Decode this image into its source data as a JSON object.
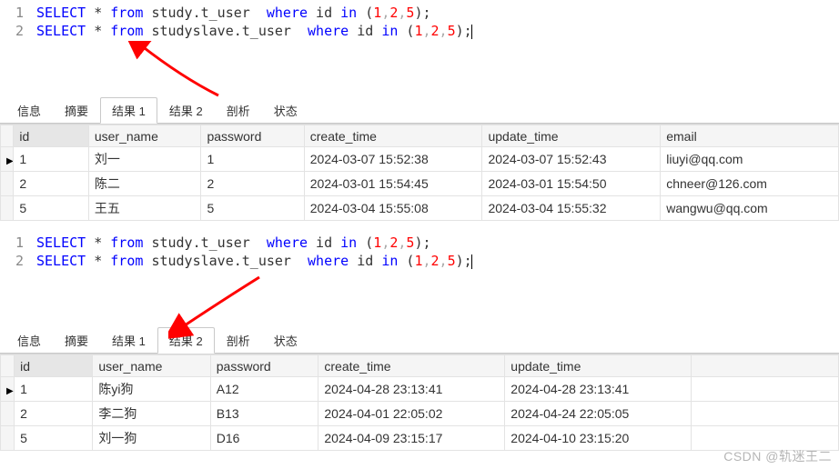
{
  "editor1": {
    "line1_num": "1",
    "line2_num": "2",
    "kw_select": "SELECT",
    "star": " * ",
    "kw_from": "from",
    "sp": " ",
    "table1": "study.t_user",
    "table2": "studyslave.t_user",
    "spc2": "  ",
    "kw_where": "where",
    "id_col": " id ",
    "kw_in": "in",
    "lp": " (",
    "n1": "1",
    "com": ",",
    "n2": "2",
    "n5": "5",
    "rp": ");"
  },
  "tabs": {
    "info": "信息",
    "summary": "摘要",
    "result1": "结果 1",
    "result2": "结果 2",
    "profile": "剖析",
    "status": "状态"
  },
  "grid1": {
    "headers": {
      "id": "id",
      "user_name": "user_name",
      "password": "password",
      "create_time": "create_time",
      "update_time": "update_time",
      "email": "email"
    },
    "rows": [
      {
        "id": "1",
        "user_name": "刘一",
        "password": "1",
        "create_time": "2024-03-07 15:52:38",
        "update_time": "2024-03-07 15:52:43",
        "email": "liuyi@qq.com"
      },
      {
        "id": "2",
        "user_name": "陈二",
        "password": "2",
        "create_time": "2024-03-01 15:54:45",
        "update_time": "2024-03-01 15:54:50",
        "email": "chneer@126.com"
      },
      {
        "id": "5",
        "user_name": "王五",
        "password": "5",
        "create_time": "2024-03-04 15:55:08",
        "update_time": "2024-03-04 15:55:32",
        "email": "wangwu@qq.com"
      }
    ]
  },
  "grid2": {
    "headers": {
      "id": "id",
      "user_name": "user_name",
      "password": "password",
      "create_time": "create_time",
      "update_time": "update_time"
    },
    "rows": [
      {
        "id": "1",
        "user_name": "陈yi狗",
        "password": "A12",
        "create_time": "2024-04-28 23:13:41",
        "update_time": "2024-04-28 23:13:41"
      },
      {
        "id": "2",
        "user_name": "李二狗",
        "password": "B13",
        "create_time": "2024-04-01 22:05:02",
        "update_time": "2024-04-24 22:05:05"
      },
      {
        "id": "5",
        "user_name": "刘一狗",
        "password": "D16",
        "create_time": "2024-04-09 23:15:17",
        "update_time": "2024-04-10 23:15:20"
      }
    ]
  },
  "watermark": "CSDN @轨迷王二"
}
